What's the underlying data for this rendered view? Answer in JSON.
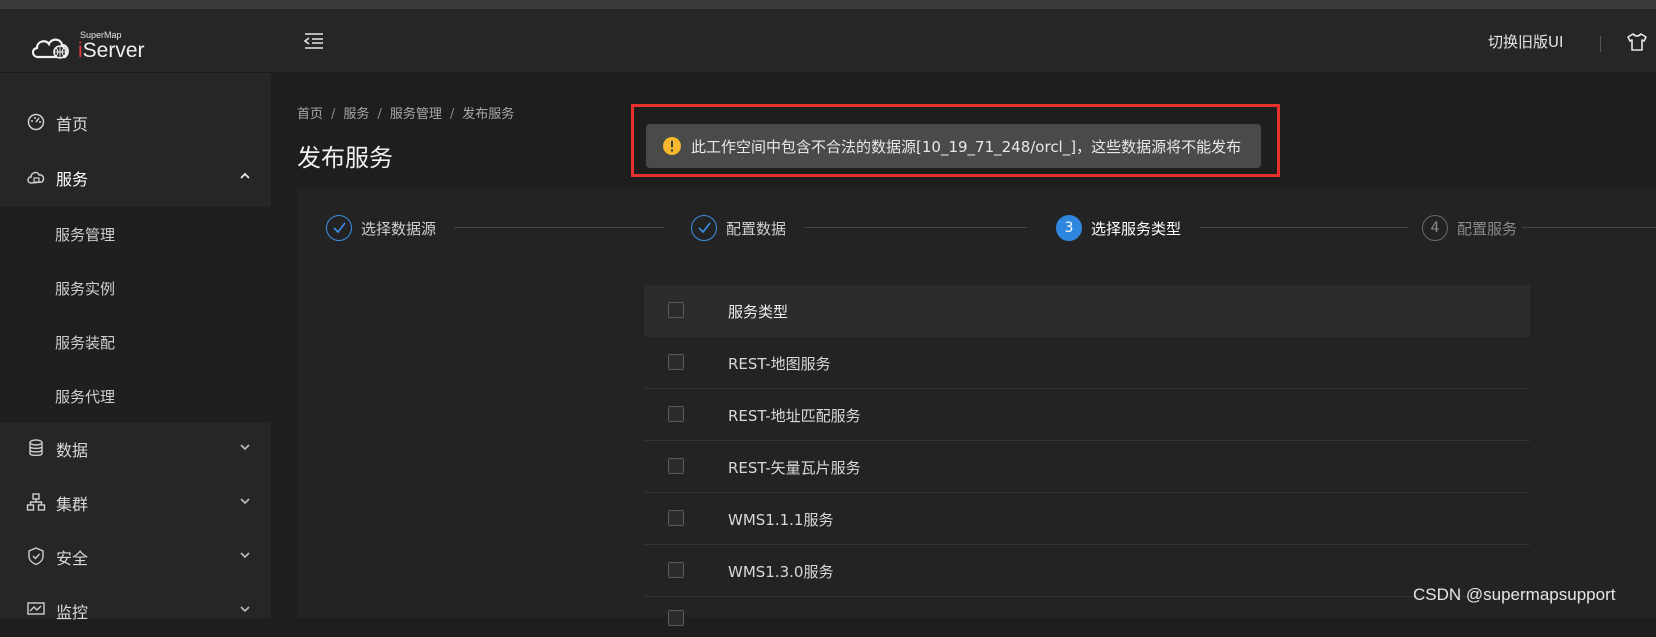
{
  "header": {
    "logo_small": "SuperMap",
    "logo_i": "i",
    "logo_big": "Server",
    "switch_ui_label": "切换旧版UI"
  },
  "sidebar": {
    "items": [
      {
        "label": "首页",
        "icon": "dashboard-icon"
      },
      {
        "label": "服务",
        "icon": "cloud-icon",
        "expanded": true
      },
      {
        "label": "数据",
        "icon": "database-icon"
      },
      {
        "label": "集群",
        "icon": "cluster-icon"
      },
      {
        "label": "安全",
        "icon": "shield-icon"
      },
      {
        "label": "监控",
        "icon": "monitor-icon"
      }
    ],
    "sub_items": [
      {
        "label": "服务管理"
      },
      {
        "label": "服务实例"
      },
      {
        "label": "服务装配"
      },
      {
        "label": "服务代理"
      }
    ]
  },
  "breadcrumb": [
    "首页",
    "服务",
    "服务管理",
    "发布服务"
  ],
  "breadcrumb_separator": "/",
  "page_title": "发布服务",
  "toast": {
    "type": "warning",
    "message": "此工作空间中包含不合法的数据源[10_19_71_248/orcl_]，这些数据源将不能发布"
  },
  "steps": [
    {
      "label": "选择数据源",
      "status": "done"
    },
    {
      "label": "配置数据",
      "status": "done"
    },
    {
      "number": "3",
      "label": "选择服务类型",
      "status": "current"
    },
    {
      "number": "4",
      "label": "配置服务",
      "status": "todo"
    }
  ],
  "table": {
    "header": "服务类型",
    "rows": [
      "REST-地图服务",
      "REST-地址匹配服务",
      "REST-矢量瓦片服务",
      "WMS1.1.1服务",
      "WMS1.3.0服务"
    ]
  },
  "watermark": "CSDN @supermapsupport",
  "colors": {
    "accent": "#2e86de",
    "highlight": "#e8302c",
    "warning": "#f5b82e",
    "background": "#1e1e1e",
    "sidebar": "#262626"
  }
}
